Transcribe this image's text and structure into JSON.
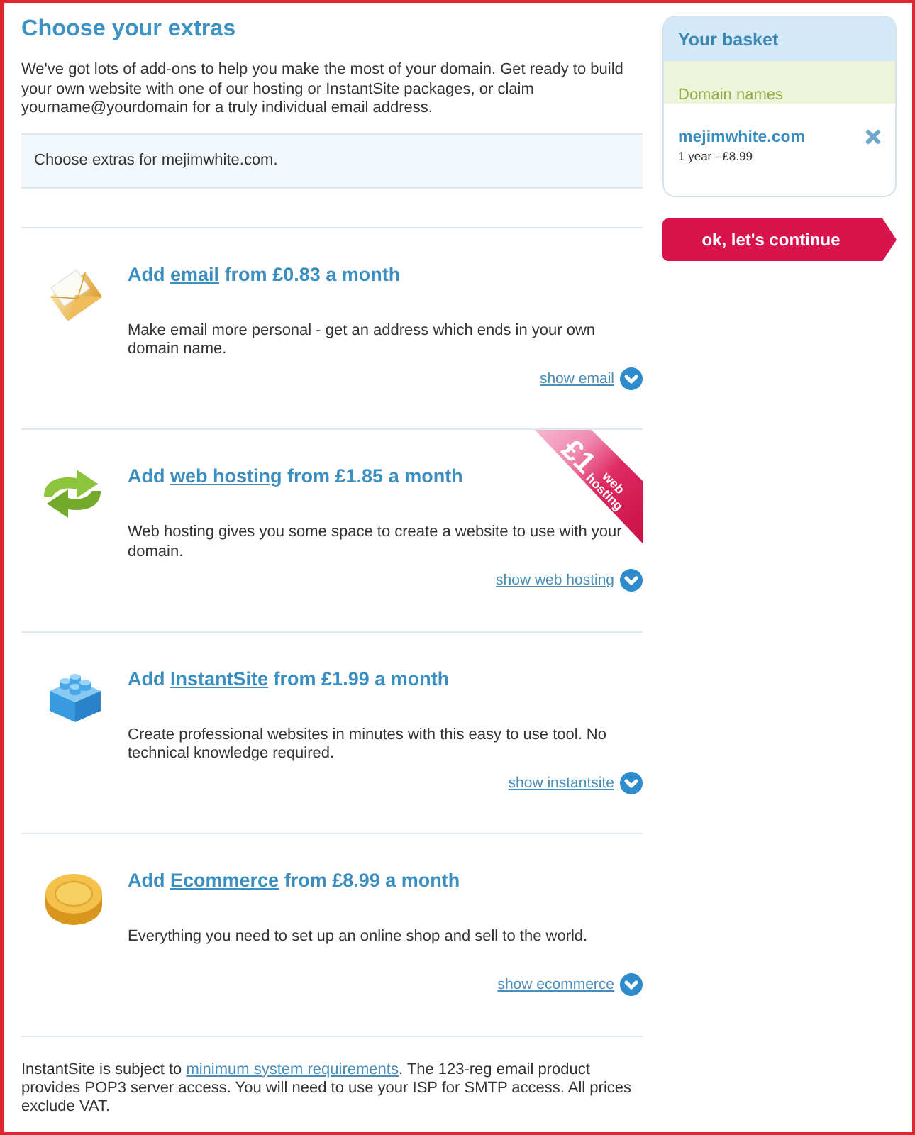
{
  "page": {
    "title": "Choose your extras",
    "intro": "We've got lots of add-ons to help you make the most of your domain. Get ready to build your own website with one of our hosting or InstantSite packages, or claim yourname@yourdomain for a truly individual email address."
  },
  "domain_notice": "Choose extras for mejimwhite.com.",
  "extras": [
    {
      "kind": "email",
      "heading": {
        "prefix": "Add",
        "link": "email",
        "suffix": "from £0.83 a month"
      },
      "description": "Make email more personal - get an address which ends in your own domain name.",
      "toggle": "show email"
    },
    {
      "kind": "hosting",
      "heading": {
        "prefix": "Add",
        "link": "web hosting",
        "suffix": "from £1.85 a month"
      },
      "description": "Web hosting gives you some space to create a website to use with your domain.",
      "toggle": "show web hosting",
      "ribbon": {
        "price": "£1",
        "label": "web hosting"
      }
    },
    {
      "kind": "instantsite",
      "heading": {
        "prefix": "Add",
        "link": "InstantSite",
        "suffix": "from £1.99 a month"
      },
      "description": "Create professional websites in minutes with this easy to use tool. No technical knowledge required.",
      "toggle": "show instantsite"
    },
    {
      "kind": "ecommerce",
      "heading": {
        "prefix": "Add",
        "link": "Ecommerce",
        "suffix": "from £8.99 a month"
      },
      "description": "Everything you need to set up an online shop and sell to the world.",
      "toggle": "show ecommerce"
    }
  ],
  "footer": {
    "prefix": "InstantSite is subject to",
    "link": "minimum system requirements",
    "suffix": ". The 123-reg email product provides POP3 server access. You will need to use your ISP for SMTP access. All prices exclude VAT."
  },
  "basket": {
    "title": "Your basket",
    "section": "Domain names",
    "items": [
      {
        "name": "mejimwhite.com",
        "detail": "1 year - £8.99"
      }
    ]
  },
  "continue_button": "ok, let's continue"
}
